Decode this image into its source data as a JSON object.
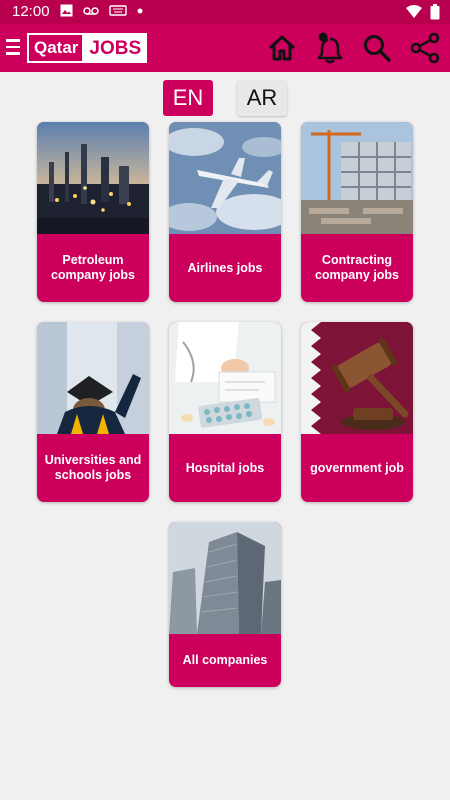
{
  "status_bar": {
    "time": "12:00",
    "left_icons": [
      "image-icon",
      "voicemail-icon",
      "keyboard-icon",
      "dot-icon"
    ],
    "right_icons": [
      "wifi-icon",
      "battery-icon"
    ]
  },
  "app_bar": {
    "logo_left": "Qatar",
    "logo_right": "JOBS",
    "actions": [
      "home-icon",
      "notification-bell-icon",
      "search-icon",
      "share-icon"
    ]
  },
  "language": {
    "en_label": "EN",
    "ar_label": "AR",
    "selected": "EN"
  },
  "categories": [
    {
      "label": "Petroleum company jobs",
      "image": "oil-refinery-at-dusk"
    },
    {
      "label": "Airlines jobs",
      "image": "airplane-in-sky"
    },
    {
      "label": "Contracting company jobs",
      "image": "construction-site"
    },
    {
      "label": "Universities and schools jobs",
      "image": "graduate-with-cap"
    },
    {
      "label": "Hospital jobs",
      "image": "doctor-with-pills"
    },
    {
      "label": "government job",
      "image": "gavel-and-flag"
    },
    {
      "label": "All companies",
      "image": "office-skyscraper"
    }
  ],
  "colors": {
    "brand": "#cc005c",
    "status_bar": "#b8004f",
    "background": "#f0f0f0"
  }
}
